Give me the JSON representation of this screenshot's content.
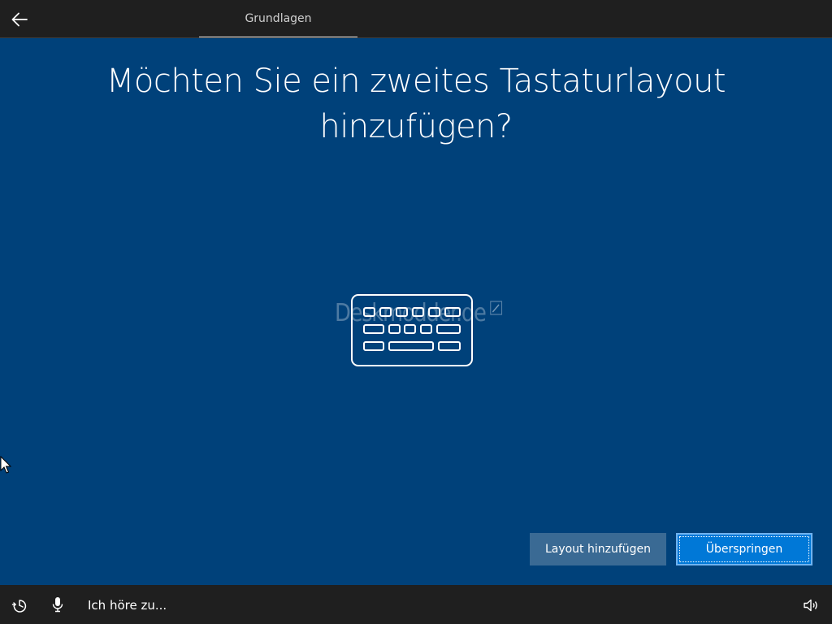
{
  "header": {
    "tab_label": "Grundlagen"
  },
  "main": {
    "title_line1": "Möchten Sie ein zweites Tastaturlayout",
    "title_line2": "hinzufügen?",
    "watermark": "Deskmodder.de"
  },
  "actions": {
    "add_layout_label": "Layout hinzufügen",
    "skip_label": "Überspringen"
  },
  "footer": {
    "listening_text": "Ich höre zu..."
  },
  "icons": {
    "back": "back-arrow-icon",
    "keyboard": "keyboard-icon",
    "ease_of_access": "ease-of-access-icon",
    "microphone": "microphone-icon",
    "volume": "volume-icon",
    "cursor": "mouse-cursor-icon"
  },
  "colors": {
    "background": "#00417a",
    "bar": "#1f1f1f",
    "primary_button": "#0078d7",
    "secondary_button": "#3a6a94",
    "text": "#ffffff"
  }
}
